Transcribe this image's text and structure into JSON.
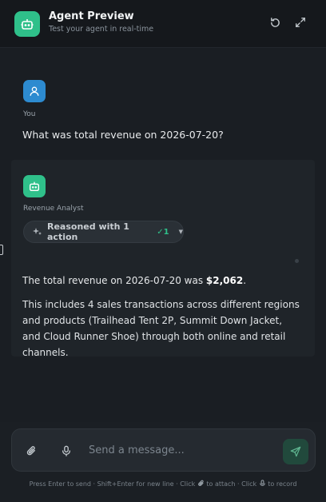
{
  "header": {
    "title": "Agent Preview",
    "subtitle": "Test your agent in real-time",
    "icons": [
      "bot-icon",
      "reset-icon",
      "expand-icon"
    ]
  },
  "messages": {
    "user": {
      "sender": "You",
      "text": "What was total revenue on 2026-07-20?"
    },
    "agent": {
      "sender": "Revenue Analyst",
      "reasoning": {
        "label": "Reasoned with 1 action",
        "count": "✓1"
      },
      "answer_prefix": "The total revenue on 2026-07-20 was ",
      "answer_amount": "$2,062",
      "answer_suffix": ".",
      "detail": "This includes 4 sales transactions across different regions and products (Trailhead Tent 2P, Summit Down Jacket, and Cloud Runner Shoe) through both online and retail channels."
    }
  },
  "composer": {
    "placeholder": "Send a message...",
    "value": ""
  },
  "hint": {
    "part1": "Press Enter to send · Shift+Enter for new line · Click",
    "part2": "to attach · Click",
    "part3": "to record"
  },
  "colors": {
    "accent": "#2fc08a",
    "user_avatar": "#2d8bd0",
    "background": "#1a1e23"
  }
}
